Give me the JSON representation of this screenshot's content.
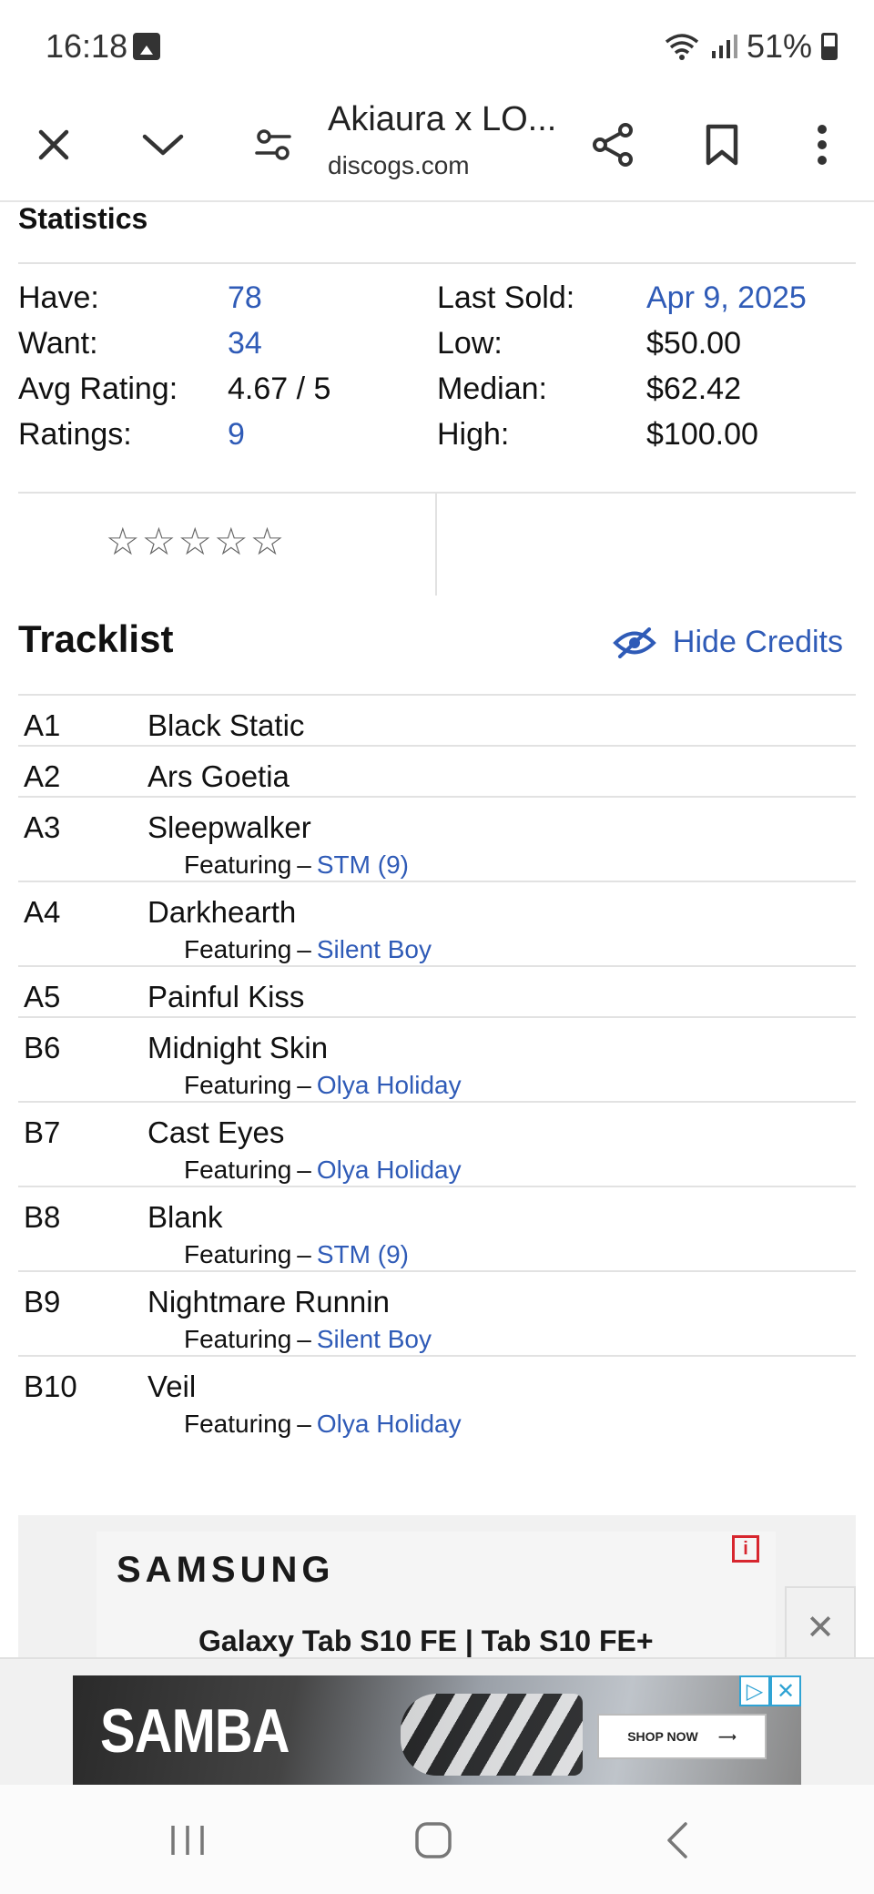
{
  "status_bar": {
    "time": "16:18",
    "battery": "51%"
  },
  "toolbar": {
    "title": "Akiaura x LO...",
    "url": "discogs.com"
  },
  "statistics": {
    "heading": "Statistics",
    "left": [
      {
        "label": "Have:",
        "value": "78",
        "link": true
      },
      {
        "label": "Want:",
        "value": "34",
        "link": true
      },
      {
        "label": "Avg Rating:",
        "value": "4.67 / 5",
        "link": false
      },
      {
        "label": "Ratings:",
        "value": "9",
        "link": true
      }
    ],
    "right": [
      {
        "label": "Last Sold:",
        "value": "Apr 9, 2025",
        "link": true
      },
      {
        "label": "Low:",
        "value": "$50.00",
        "link": false
      },
      {
        "label": "Median:",
        "value": "$62.42",
        "link": false
      },
      {
        "label": "High:",
        "value": "$100.00",
        "link": false
      }
    ]
  },
  "tracklist": {
    "heading": "Tracklist",
    "hide_credits": "Hide Credits",
    "featuring_label": "Featuring",
    "tracks": [
      {
        "pos": "A1",
        "title": "Black Static",
        "featuring": ""
      },
      {
        "pos": "A2",
        "title": "Ars Goetia",
        "featuring": ""
      },
      {
        "pos": "A3",
        "title": "Sleepwalker",
        "featuring": "STM (9)"
      },
      {
        "pos": "A4",
        "title": "Darkhearth",
        "featuring": "Silent Boy"
      },
      {
        "pos": "A5",
        "title": "Painful Kiss",
        "featuring": ""
      },
      {
        "pos": "B6",
        "title": "Midnight Skin",
        "featuring": "Olya Holiday"
      },
      {
        "pos": "B7",
        "title": "Cast Eyes",
        "featuring": "Olya Holiday"
      },
      {
        "pos": "B8",
        "title": "Blank",
        "featuring": "STM (9)"
      },
      {
        "pos": "B9",
        "title": "Nightmare Runnin",
        "featuring": "Silent Boy"
      },
      {
        "pos": "B10",
        "title": "Veil",
        "featuring": "Olya Holiday"
      }
    ]
  },
  "ads": {
    "samsung_logo": "SAMSUNG",
    "samsung_text": "Galaxy Tab S10 FE | Tab S10 FE+",
    "samba_text": "SAMBA",
    "shop_now": "SHOP NOW"
  },
  "colors": {
    "link": "#2f5bb7",
    "divider": "#e2e2e2"
  }
}
